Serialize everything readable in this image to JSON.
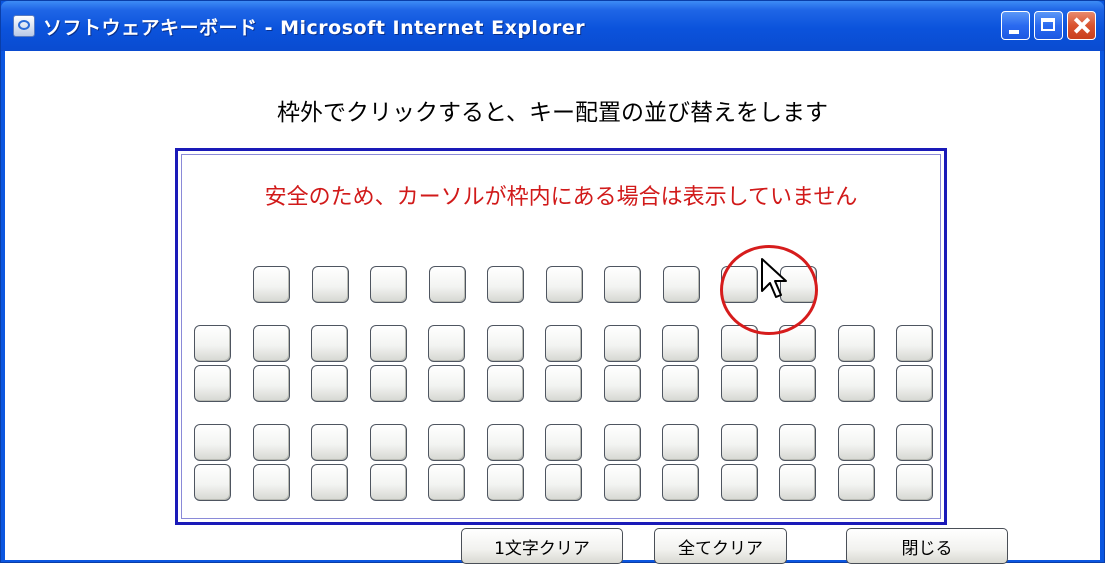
{
  "window": {
    "title": "ソフトウェアキーボード - Microsoft Internet Explorer",
    "icon": "ie-page-icon",
    "controls": [
      "minimize",
      "maximize",
      "close"
    ]
  },
  "heading": "枠外でクリックすると、キー配置の並び替えをします",
  "keyboard": {
    "warning": "安全のため、カーソルが枠内にある場合は表示していません",
    "rows": [
      {
        "count": 10,
        "label": "row-1"
      },
      {
        "count": 13,
        "label": "row-2"
      },
      {
        "count": 13,
        "label": "row-3"
      },
      {
        "count": 13,
        "label": "row-4"
      },
      {
        "count": 13,
        "label": "row-5"
      }
    ]
  },
  "buttons": {
    "clear_one": "1文字クリア",
    "clear_all": "全てクリア",
    "close": "閉じる"
  },
  "colors": {
    "title_bar": "#0b53dc",
    "frame_border": "#1a1ab8",
    "warning_text": "#d11a1a",
    "highlight_circle": "#d61c1c"
  }
}
